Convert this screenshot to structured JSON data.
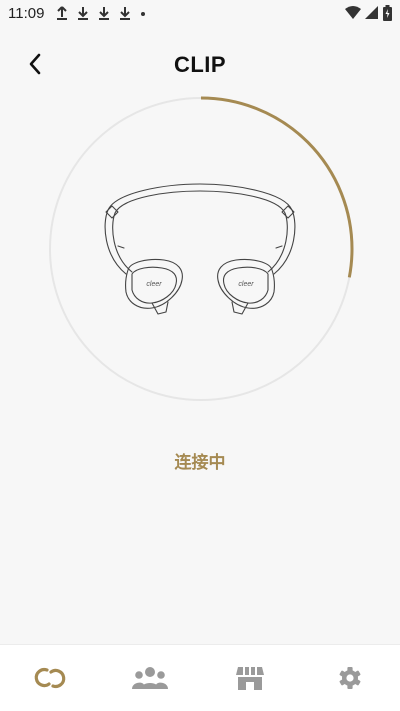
{
  "status_bar": {
    "time": "11:09"
  },
  "header": {
    "title": "CLIP"
  },
  "connection": {
    "status_text": "连接中",
    "progress_fraction": 0.28,
    "device_logo_text": "cleer"
  },
  "tabs": [
    {
      "icon": "link-icon",
      "active": true
    },
    {
      "icon": "people-icon",
      "active": false
    },
    {
      "icon": "store-icon",
      "active": false
    },
    {
      "icon": "gear-icon",
      "active": false
    }
  ],
  "colors": {
    "accent": "#a58a52",
    "inactive_icon": "#9a9a9a",
    "track": "#e6e6e6"
  }
}
